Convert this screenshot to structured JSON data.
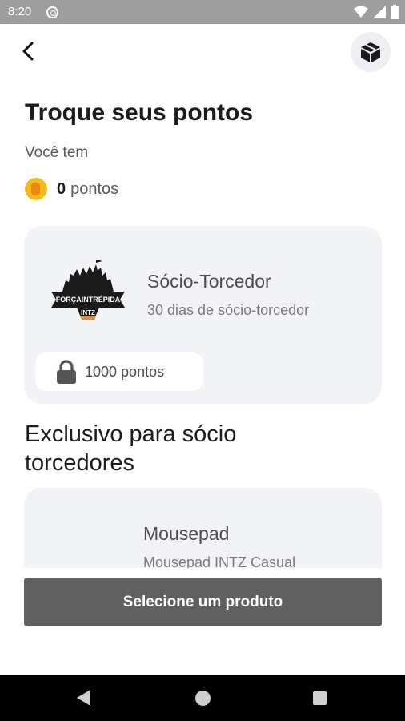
{
  "status_bar": {
    "time": "8:20"
  },
  "header": {
    "title": "Troque seus pontos"
  },
  "balance": {
    "label": "Você tem",
    "value": "0",
    "unit": "pontos"
  },
  "rewards": [
    {
      "logo_text": [
        "FORÇAINTRÉPIDA",
        "INTZ"
      ],
      "name": "Sócio-Torcedor",
      "description": "30 dias de sócio-torcedor",
      "price": "1000 pontos"
    }
  ],
  "exclusive": {
    "title": "Exclusivo para sócio torcedores",
    "items": [
      {
        "name": "Mousepad",
        "description": "Mousepad INTZ Casual"
      }
    ]
  },
  "cta": {
    "label": "Selecione um produto"
  },
  "icons": {
    "back": "arrow-left-icon",
    "box": "package-icon",
    "coin": "coin-icon",
    "lock": "lock-icon"
  },
  "colors": {
    "accent_coin": "#f6b91a",
    "card_bg": "#f2f3f6",
    "button_bg": "#606060"
  }
}
